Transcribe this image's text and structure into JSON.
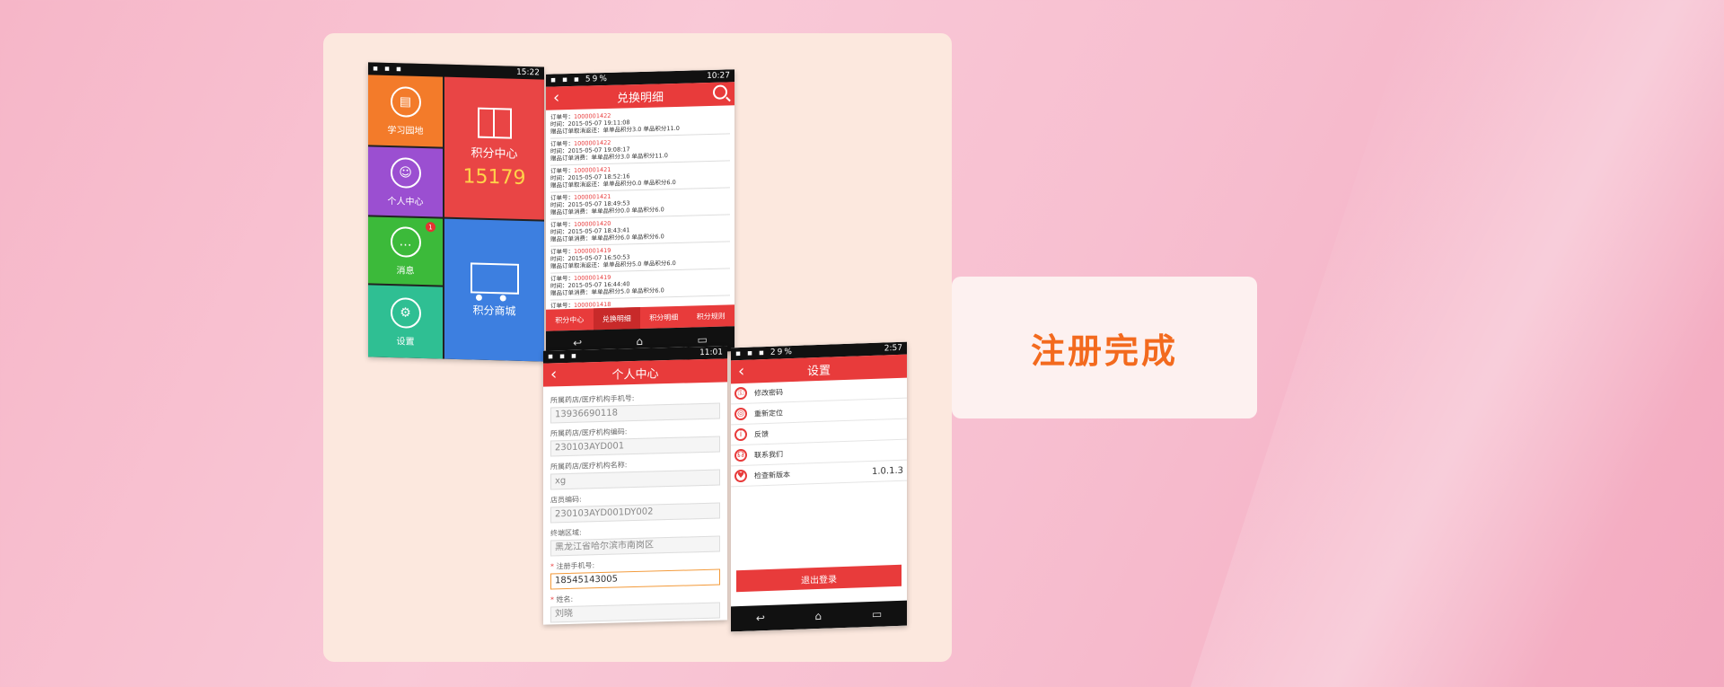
{
  "caption": "注册完成",
  "colors": {
    "accent": "#e83b3b",
    "caption": "#f36a1e"
  },
  "phone1": {
    "time": "15:22",
    "tiles": {
      "study": "学习园地",
      "personal": "个人中心",
      "messages": "消息",
      "messages_badge": "1",
      "settings": "设置",
      "points_center": "积分中心",
      "points_value": "15179",
      "points_mall": "积分商城"
    }
  },
  "phone2": {
    "time": "10:27",
    "battery": "59%",
    "title": "兑换明细",
    "order_label": "订单号：",
    "entries": [
      {
        "order": "1000001422",
        "time": "时间：2015-05-07 19:11:08",
        "detail": "赠品订单取消返还：单单品积分3.0  单品积分11.0"
      },
      {
        "order": "1000001422",
        "time": "时间：2015-05-07 19:08:17",
        "detail": "赠品订单消费：单单品积分3.0  单品积分11.0"
      },
      {
        "order": "1000001421",
        "time": "时间：2015-05-07 18:52:16",
        "detail": "赠品订单取消返还：单单品积分0.0  单品积分6.0"
      },
      {
        "order": "1000001421",
        "time": "时间：2015-05-07 18:49:53",
        "detail": "赠品订单消费：单单品积分0.0  单品积分6.0"
      },
      {
        "order": "1000001420",
        "time": "时间：2015-05-07 18:43:41",
        "detail": "赠品订单消费：单单品积分6.0  单品积分6.0"
      },
      {
        "order": "1000001419",
        "time": "时间：2015-05-07 16:50:53",
        "detail": "赠品订单取消返还：单单品积分5.0  单品积分6.0"
      },
      {
        "order": "1000001419",
        "time": "时间：2015-05-07 16:44:40",
        "detail": "赠品订单消费：单单品积分5.0  单品积分6.0"
      },
      {
        "order": "1000001418",
        "time": "",
        "detail": ""
      }
    ],
    "tabs": [
      "积分中心",
      "兑换明细",
      "积分明细",
      "积分规则"
    ]
  },
  "phone3": {
    "time": "11:01",
    "title": "个人中心",
    "fields": [
      {
        "label": "所属药店/医疗机构手机号:",
        "value": "13936690118"
      },
      {
        "label": "所属药店/医疗机构编码:",
        "value": "230103AYD001"
      },
      {
        "label": "所属药店/医疗机构名称:",
        "value": "xg"
      },
      {
        "label": "店员编码:",
        "value": "230103AYD001DY002"
      },
      {
        "label": "终端区域:",
        "value": "黑龙江省哈尔滨市南岗区"
      },
      {
        "label": "注册手机号:",
        "value": "18545143005"
      },
      {
        "label": "姓名:",
        "value": "刘晓"
      }
    ]
  },
  "phone4": {
    "time": "2:57",
    "battery": "29%",
    "title": "设置",
    "items": [
      "修改密码",
      "重新定位",
      "反馈",
      "联系我们",
      "检查新版本"
    ],
    "version": "1.0.1.3",
    "logout": "退出登录"
  },
  "icons": {
    "back": "‹",
    "home": "⌂",
    "recent": "▭",
    "return": "↩"
  }
}
